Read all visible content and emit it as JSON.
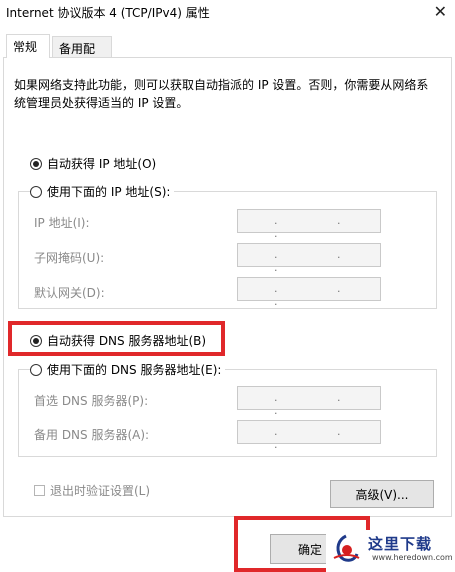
{
  "window": {
    "title": "Internet 协议版本 4 (TCP/IPv4) 属性",
    "close_glyph": "✕"
  },
  "tabs": [
    {
      "label": "常规"
    },
    {
      "label": "备用配置"
    }
  ],
  "description": "如果网络支持此功能，则可以获取自动指派的 IP 设置。否则，你需要从网络系统管理员处获得适当的 IP 设置。",
  "ip": {
    "auto_label": "自动获得 IP 地址(O)",
    "auto_selected": true,
    "manual_label": "使用下面的 IP 地址(S):",
    "fields": [
      {
        "label": "IP 地址(I):",
        "value": ". . ."
      },
      {
        "label": "子网掩码(U):",
        "value": ". . ."
      },
      {
        "label": "默认网关(D):",
        "value": ". . ."
      }
    ]
  },
  "dns": {
    "auto_label": "自动获得 DNS 服务器地址(B)",
    "auto_selected": true,
    "manual_label": "使用下面的 DNS 服务器地址(E):",
    "fields": [
      {
        "label": "首选 DNS 服务器(P):",
        "value": ". . ."
      },
      {
        "label": "备用 DNS 服务器(A):",
        "value": ". . ."
      }
    ]
  },
  "validate_on_exit": {
    "label": "退出时验证设置(L)",
    "checked": false
  },
  "buttons": {
    "advanced": "高级(V)...",
    "ok": "确定"
  },
  "watermark": {
    "cn": "这里下载",
    "en": "www.heredown.com"
  },
  "colors": {
    "highlight": "#e0282a",
    "brand": "#1f3a8a"
  }
}
